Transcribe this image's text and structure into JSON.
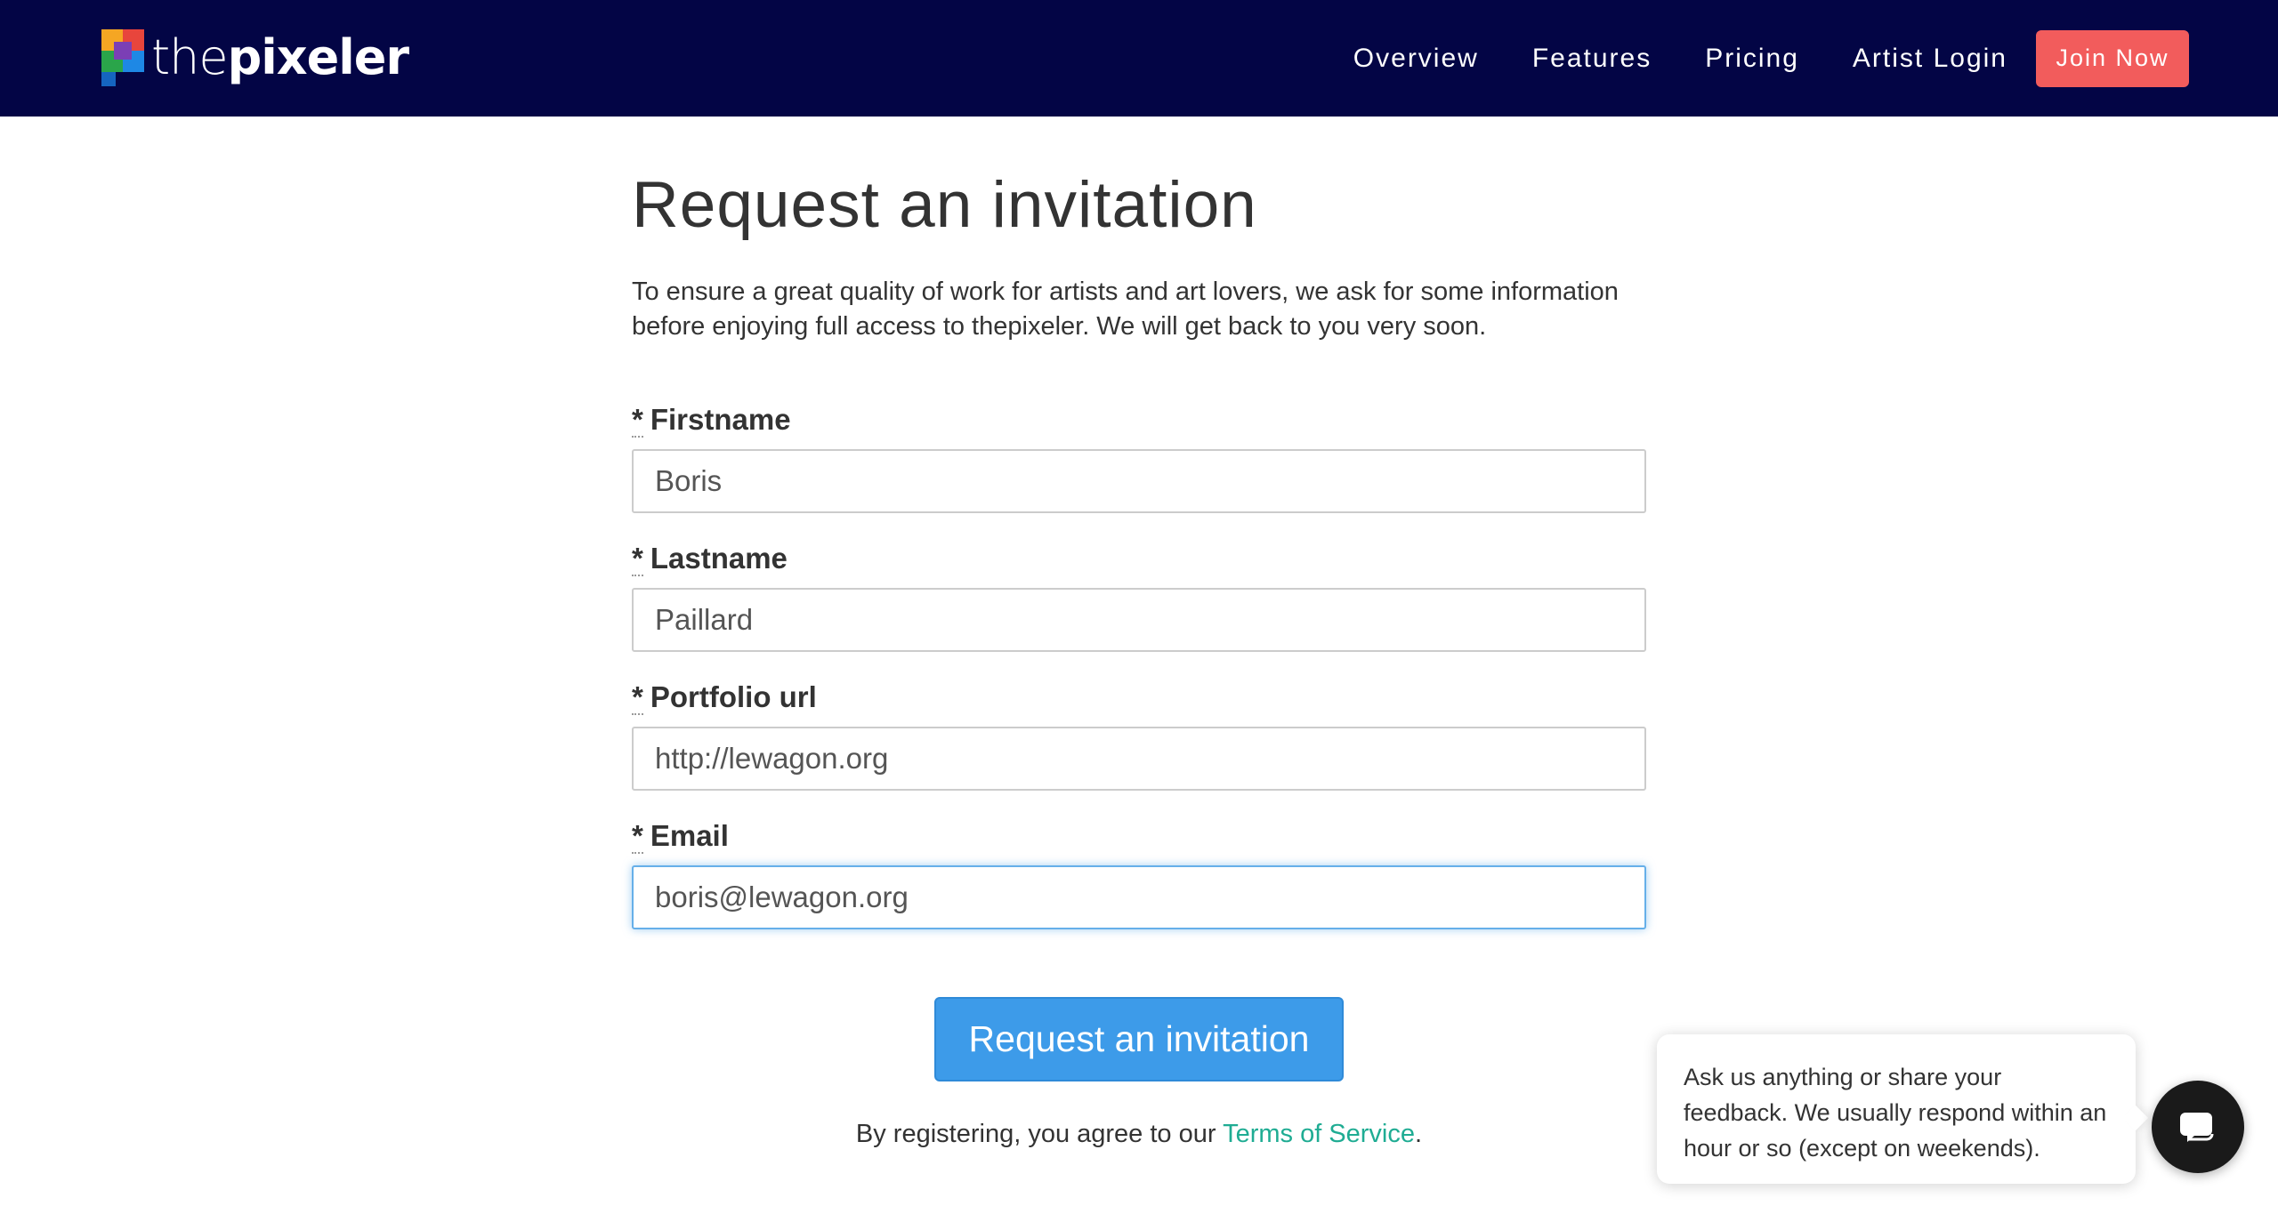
{
  "navbar": {
    "brand": {
      "prefix": "the",
      "name": "pixeler"
    },
    "links": [
      "Overview",
      "Features",
      "Pricing",
      "Artist Login"
    ],
    "cta": "Join Now",
    "background": "#030545",
    "cta_color": "#f25c5c"
  },
  "page": {
    "title": "Request an invitation",
    "intro": "To ensure a great quality of work for artists and art lovers, we ask for some information before enjoying full access to thepixeler. We will get back to you very soon."
  },
  "form": {
    "required_marker": "*",
    "fields": [
      {
        "label": "Firstname",
        "value": "Boris"
      },
      {
        "label": "Lastname",
        "value": "Paillard"
      },
      {
        "label": "Portfolio url",
        "value": "http://lewagon.org"
      },
      {
        "label": "Email",
        "value": "boris@lewagon.org",
        "focused": true
      }
    ],
    "submit": "Request an invitation",
    "submit_color": "#3d9be9",
    "terms_prefix": "By registering, you agree to our ",
    "terms_link": "Terms of Service",
    "terms_suffix": ".",
    "link_color": "#1fac93"
  },
  "chat": {
    "message": "Ask us anything or share your feedback. We usually respond within an hour or so (except on weekends).",
    "launcher_icon": "chat-icon"
  }
}
